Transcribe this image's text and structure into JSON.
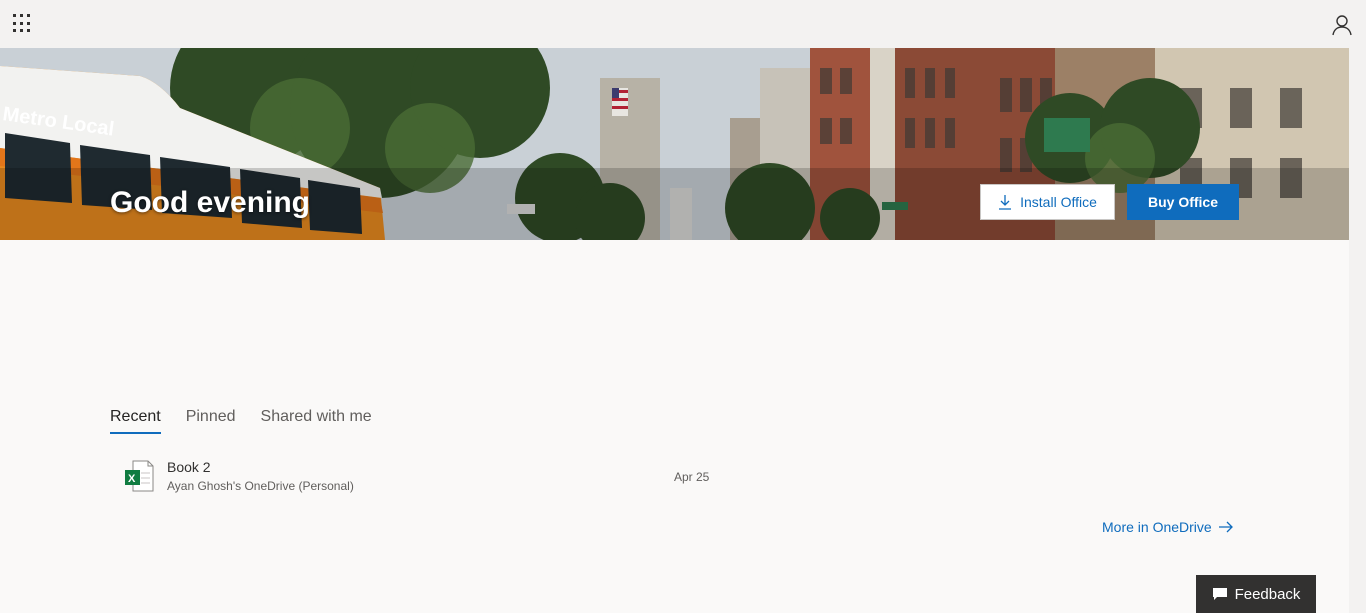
{
  "header": {
    "app_launcher_icon": "waffle-icon",
    "profile_icon": "person-icon"
  },
  "hero": {
    "greeting": "Good evening",
    "bus_sign": "Metro Local",
    "install_label": "Install Office",
    "install_icon": "download-icon",
    "buy_label": "Buy Office"
  },
  "tabs": [
    {
      "label": "Recent",
      "active": true
    },
    {
      "label": "Pinned",
      "active": false
    },
    {
      "label": "Shared with me",
      "active": false
    }
  ],
  "files": [
    {
      "name": "Book 2",
      "location": "Ayan Ghosh's OneDrive (Personal)",
      "date": "Apr 25",
      "icon": "excel-file-icon"
    }
  ],
  "more_link": "More in OneDrive",
  "feedback_label": "Feedback",
  "colors": {
    "accent": "#0f6cbd",
    "excel_green": "#107c41",
    "background": "#faf9f8",
    "topbar": "#f3f2f1"
  }
}
